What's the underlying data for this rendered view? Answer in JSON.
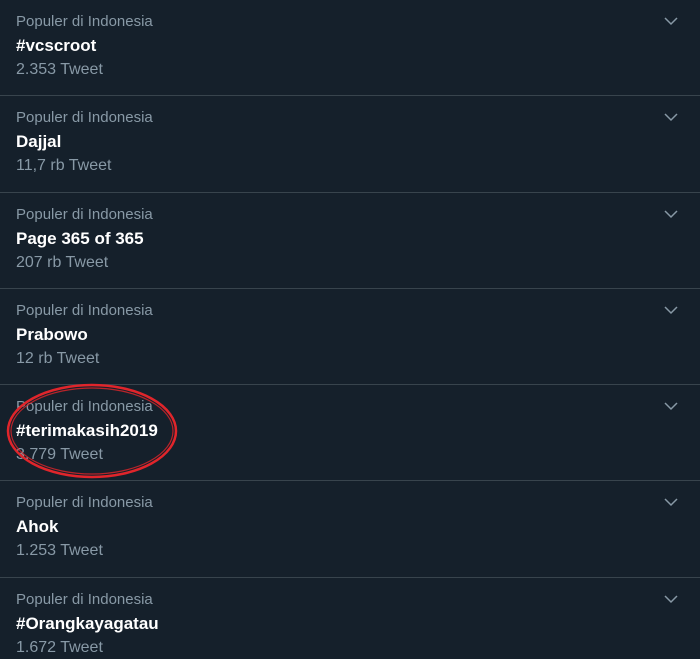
{
  "colors": {
    "background": "#15202b",
    "divider": "#38444d",
    "secondary_text": "#8899a6",
    "primary_text": "#ffffff",
    "highlight_ring": "#e0252b"
  },
  "trends": [
    {
      "context": "Populer di Indonesia",
      "name": "#vcscroot",
      "count": "2.353 Tweet",
      "icon": "chevron-down-icon"
    },
    {
      "context": "Populer di Indonesia",
      "name": "Dajjal",
      "count": "11,7 rb Tweet",
      "icon": "chevron-down-icon"
    },
    {
      "context": "Populer di Indonesia",
      "name": "Page 365 of 365",
      "count": "207 rb Tweet",
      "icon": "chevron-down-icon"
    },
    {
      "context": "Populer di Indonesia",
      "name": "Prabowo",
      "count": "12 rb Tweet",
      "icon": "chevron-down-icon"
    },
    {
      "context": "Populer di Indonesia",
      "name": "#terimakasih2019",
      "count": "3.779 Tweet",
      "icon": "chevron-down-icon"
    },
    {
      "context": "Populer di Indonesia",
      "name": "Ahok",
      "count": "1.253 Tweet",
      "icon": "chevron-down-icon"
    },
    {
      "context": "Populer di Indonesia",
      "name": "#Orangkayagatau",
      "count": "1.672 Tweet",
      "icon": "chevron-down-icon"
    }
  ]
}
